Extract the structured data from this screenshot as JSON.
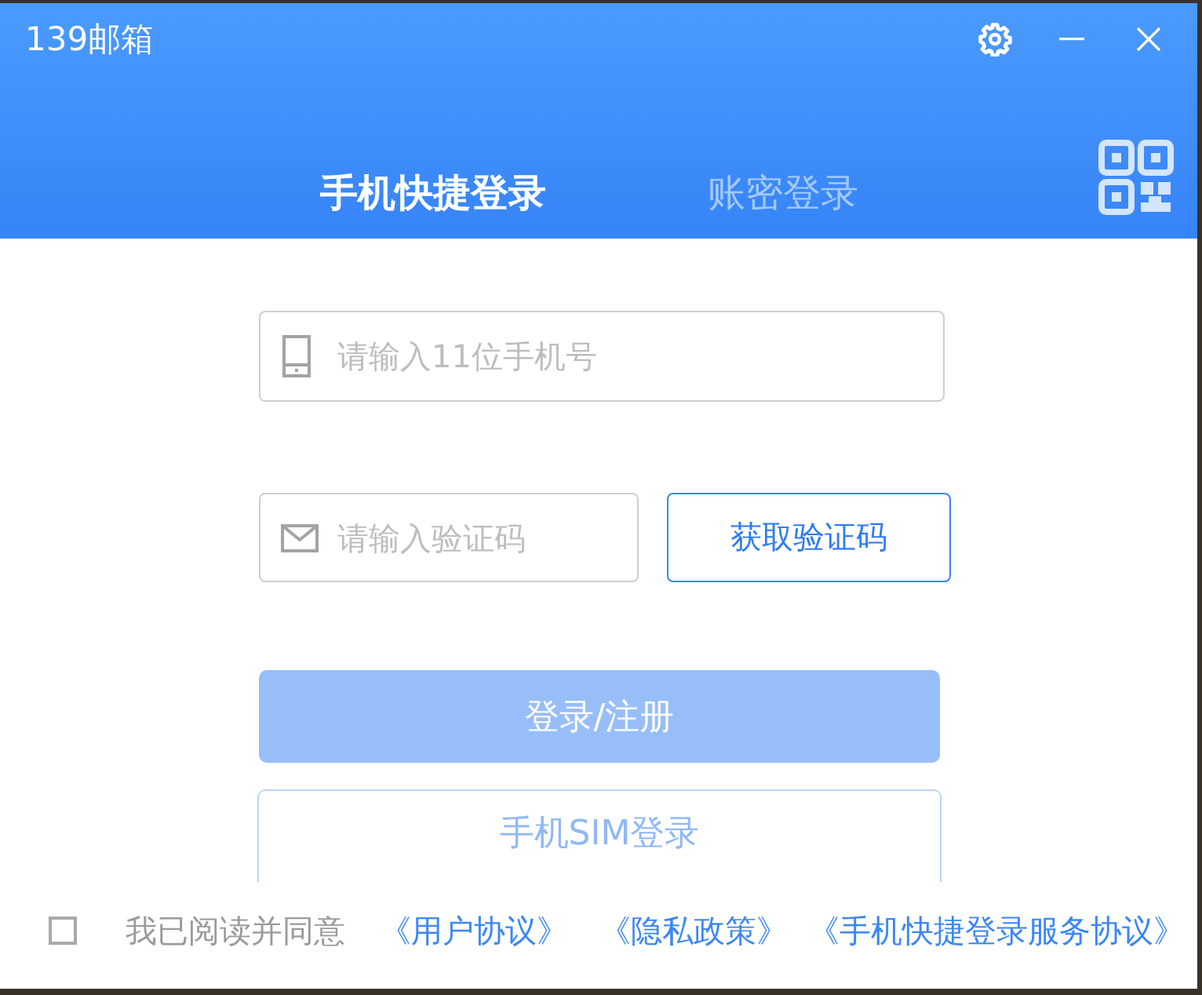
{
  "window": {
    "title": "139邮箱"
  },
  "tabs": [
    {
      "label": "手机快捷登录",
      "selected": true
    },
    {
      "label": "账密登录",
      "selected": false
    }
  ],
  "form": {
    "phone": {
      "placeholder": "请输入11位手机号"
    },
    "code": {
      "placeholder": "请输入验证码"
    },
    "get_code_button": "获取验证码",
    "login_button": {
      "label": "登录/注册",
      "disabled": true
    },
    "sim_button": {
      "label": "手机SIM登录",
      "disabled": true
    }
  },
  "agreement": {
    "checked": false,
    "text": "我已阅读并同意",
    "links": [
      "《用户协议》",
      "《隐私政策》",
      "《手机快捷登录服务协议》"
    ]
  }
}
